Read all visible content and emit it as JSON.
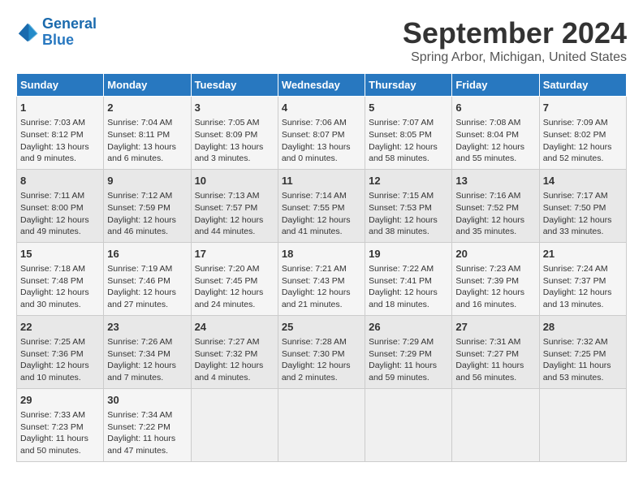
{
  "logo": {
    "line1": "General",
    "line2": "Blue"
  },
  "title": "September 2024",
  "subtitle": "Spring Arbor, Michigan, United States",
  "days_of_week": [
    "Sunday",
    "Monday",
    "Tuesday",
    "Wednesday",
    "Thursday",
    "Friday",
    "Saturday"
  ],
  "weeks": [
    [
      {
        "day": "1",
        "sunrise": "7:03 AM",
        "sunset": "8:12 PM",
        "daylight": "13 hours and 9 minutes."
      },
      {
        "day": "2",
        "sunrise": "7:04 AM",
        "sunset": "8:11 PM",
        "daylight": "13 hours and 6 minutes."
      },
      {
        "day": "3",
        "sunrise": "7:05 AM",
        "sunset": "8:09 PM",
        "daylight": "13 hours and 3 minutes."
      },
      {
        "day": "4",
        "sunrise": "7:06 AM",
        "sunset": "8:07 PM",
        "daylight": "13 hours and 0 minutes."
      },
      {
        "day": "5",
        "sunrise": "7:07 AM",
        "sunset": "8:05 PM",
        "daylight": "12 hours and 58 minutes."
      },
      {
        "day": "6",
        "sunrise": "7:08 AM",
        "sunset": "8:04 PM",
        "daylight": "12 hours and 55 minutes."
      },
      {
        "day": "7",
        "sunrise": "7:09 AM",
        "sunset": "8:02 PM",
        "daylight": "12 hours and 52 minutes."
      }
    ],
    [
      {
        "day": "8",
        "sunrise": "7:11 AM",
        "sunset": "8:00 PM",
        "daylight": "12 hours and 49 minutes."
      },
      {
        "day": "9",
        "sunrise": "7:12 AM",
        "sunset": "7:59 PM",
        "daylight": "12 hours and 46 minutes."
      },
      {
        "day": "10",
        "sunrise": "7:13 AM",
        "sunset": "7:57 PM",
        "daylight": "12 hours and 44 minutes."
      },
      {
        "day": "11",
        "sunrise": "7:14 AM",
        "sunset": "7:55 PM",
        "daylight": "12 hours and 41 minutes."
      },
      {
        "day": "12",
        "sunrise": "7:15 AM",
        "sunset": "7:53 PM",
        "daylight": "12 hours and 38 minutes."
      },
      {
        "day": "13",
        "sunrise": "7:16 AM",
        "sunset": "7:52 PM",
        "daylight": "12 hours and 35 minutes."
      },
      {
        "day": "14",
        "sunrise": "7:17 AM",
        "sunset": "7:50 PM",
        "daylight": "12 hours and 33 minutes."
      }
    ],
    [
      {
        "day": "15",
        "sunrise": "7:18 AM",
        "sunset": "7:48 PM",
        "daylight": "12 hours and 30 minutes."
      },
      {
        "day": "16",
        "sunrise": "7:19 AM",
        "sunset": "7:46 PM",
        "daylight": "12 hours and 27 minutes."
      },
      {
        "day": "17",
        "sunrise": "7:20 AM",
        "sunset": "7:45 PM",
        "daylight": "12 hours and 24 minutes."
      },
      {
        "day": "18",
        "sunrise": "7:21 AM",
        "sunset": "7:43 PM",
        "daylight": "12 hours and 21 minutes."
      },
      {
        "day": "19",
        "sunrise": "7:22 AM",
        "sunset": "7:41 PM",
        "daylight": "12 hours and 18 minutes."
      },
      {
        "day": "20",
        "sunrise": "7:23 AM",
        "sunset": "7:39 PM",
        "daylight": "12 hours and 16 minutes."
      },
      {
        "day": "21",
        "sunrise": "7:24 AM",
        "sunset": "7:37 PM",
        "daylight": "12 hours and 13 minutes."
      }
    ],
    [
      {
        "day": "22",
        "sunrise": "7:25 AM",
        "sunset": "7:36 PM",
        "daylight": "12 hours and 10 minutes."
      },
      {
        "day": "23",
        "sunrise": "7:26 AM",
        "sunset": "7:34 PM",
        "daylight": "12 hours and 7 minutes."
      },
      {
        "day": "24",
        "sunrise": "7:27 AM",
        "sunset": "7:32 PM",
        "daylight": "12 hours and 4 minutes."
      },
      {
        "day": "25",
        "sunrise": "7:28 AM",
        "sunset": "7:30 PM",
        "daylight": "12 hours and 2 minutes."
      },
      {
        "day": "26",
        "sunrise": "7:29 AM",
        "sunset": "7:29 PM",
        "daylight": "11 hours and 59 minutes."
      },
      {
        "day": "27",
        "sunrise": "7:31 AM",
        "sunset": "7:27 PM",
        "daylight": "11 hours and 56 minutes."
      },
      {
        "day": "28",
        "sunrise": "7:32 AM",
        "sunset": "7:25 PM",
        "daylight": "11 hours and 53 minutes."
      }
    ],
    [
      {
        "day": "29",
        "sunrise": "7:33 AM",
        "sunset": "7:23 PM",
        "daylight": "11 hours and 50 minutes."
      },
      {
        "day": "30",
        "sunrise": "7:34 AM",
        "sunset": "7:22 PM",
        "daylight": "11 hours and 47 minutes."
      },
      null,
      null,
      null,
      null,
      null
    ]
  ]
}
